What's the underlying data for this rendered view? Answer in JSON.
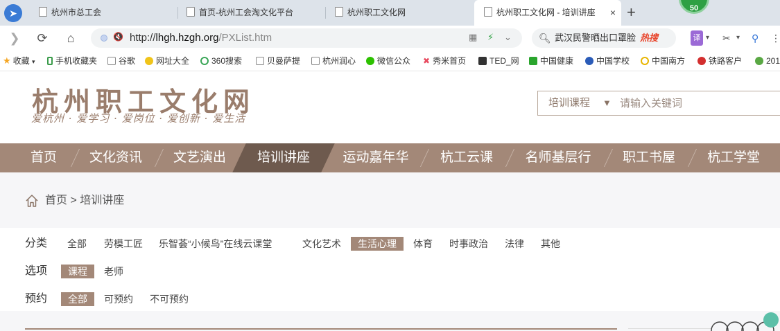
{
  "browser": {
    "tabs": [
      {
        "label": "杭州市总工会"
      },
      {
        "label": "首页-杭州工会淘文化平台"
      },
      {
        "label": "杭州职工文化网"
      },
      {
        "label": "杭州职工文化网 - 培训讲座",
        "close": "×"
      }
    ],
    "new_tab": "+",
    "badge_count": "50",
    "url": {
      "protocol": "http://",
      "domain": "lhgh.hzgh.org",
      "path": "/PXList.htm"
    },
    "search": {
      "query": "武汉民警晒出口罩脸",
      "hot_label": "热搜"
    },
    "translate": "译",
    "bookmarks": [
      {
        "label": "收藏",
        "color": "#f5a623"
      },
      {
        "label": "手机收藏夹",
        "color": "#3a9b4a"
      },
      {
        "label": "谷歌",
        "color": "#ffffff"
      },
      {
        "label": "网址大全",
        "color": "#f0c419"
      },
      {
        "label": "360搜索",
        "color": "#3aa657"
      },
      {
        "label": "贝曼萨提",
        "color": "#ffffff"
      },
      {
        "label": "杭州润心",
        "color": "#ffffff"
      },
      {
        "label": "微信公众",
        "color": "#2dc100"
      },
      {
        "label": "秀米首页",
        "color": "#e84a5f"
      },
      {
        "label": "TED_网",
        "color": "#333333"
      },
      {
        "label": "中国健康",
        "color": "#2aa52d"
      },
      {
        "label": "中国学校",
        "color": "#2b5cb8"
      },
      {
        "label": "中国南方",
        "color": "#e8b500"
      },
      {
        "label": "铁路客户",
        "color": "#d32f2f"
      },
      {
        "label": "201",
        "color": "#5aa844"
      }
    ]
  },
  "site": {
    "title": "杭州职工文化网",
    "slogan": "爱杭州 · 爱学习 · 爱岗位 · 爱创新 · 爱生活",
    "search": {
      "category": "培训课程",
      "arrow": "▼",
      "placeholder": "请输入关键词"
    },
    "nav": [
      {
        "label": "首页"
      },
      {
        "label": "文化资讯"
      },
      {
        "label": "文艺演出"
      },
      {
        "label": "培训讲座",
        "active": true
      },
      {
        "label": "运动嘉年华"
      },
      {
        "label": "杭工云课"
      },
      {
        "label": "名师基层行"
      },
      {
        "label": "职工书屋"
      },
      {
        "label": "杭工学堂"
      }
    ],
    "breadcrumb": {
      "home": "首页",
      "separator": ">",
      "current": "培训讲座"
    },
    "filters": {
      "category": {
        "label": "分类",
        "options": [
          "全部",
          "劳模工匠",
          "乐智荟“小候鸟”在线云课堂",
          "文化艺术",
          "生活心理",
          "体育",
          "时事政治",
          "法律",
          "其他"
        ],
        "selected": "生活心理"
      },
      "option": {
        "label": "选项",
        "options": [
          "课程",
          "老师"
        ],
        "selected": "课程"
      },
      "booking": {
        "label": "预约",
        "options": [
          "全部",
          "可预约",
          "不可预约"
        ],
        "selected": "全部"
      }
    },
    "accent_color": "#a38878",
    "nav_active_color": "#6e5a4e"
  }
}
